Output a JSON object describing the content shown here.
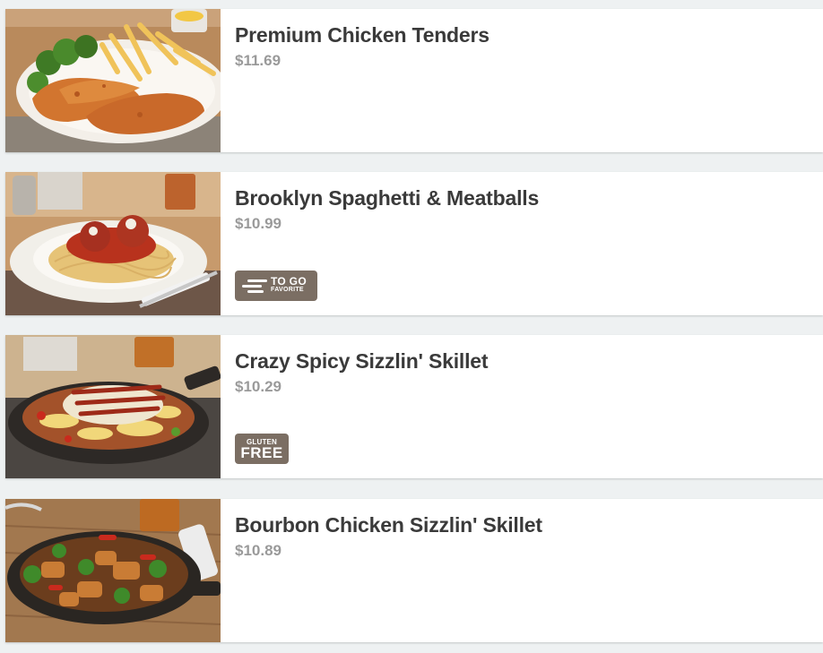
{
  "menu": {
    "items": [
      {
        "name": "Premium Chicken Tenders",
        "price": "$11.69",
        "image_icon": "chicken-tenders-photo"
      },
      {
        "name": "Brooklyn Spaghetti & Meatballs",
        "price": "$10.99",
        "image_icon": "spaghetti-meatballs-photo",
        "badge": {
          "line1": "TO GO",
          "line2": "FAVORITE"
        }
      },
      {
        "name": "Crazy Spicy Sizzlin' Skillet",
        "price": "$10.29",
        "image_icon": "spicy-skillet-photo",
        "badge": {
          "line1": "GLUTEN",
          "line2": "FREE"
        }
      },
      {
        "name": "Bourbon Chicken Sizzlin' Skillet",
        "price": "$10.89",
        "image_icon": "bourbon-skillet-photo"
      }
    ]
  },
  "colors": {
    "background": "#eef1f2",
    "card": "#ffffff",
    "title": "#3a3a3a",
    "price": "#9a9a9a",
    "badge": "#7b6e63"
  }
}
